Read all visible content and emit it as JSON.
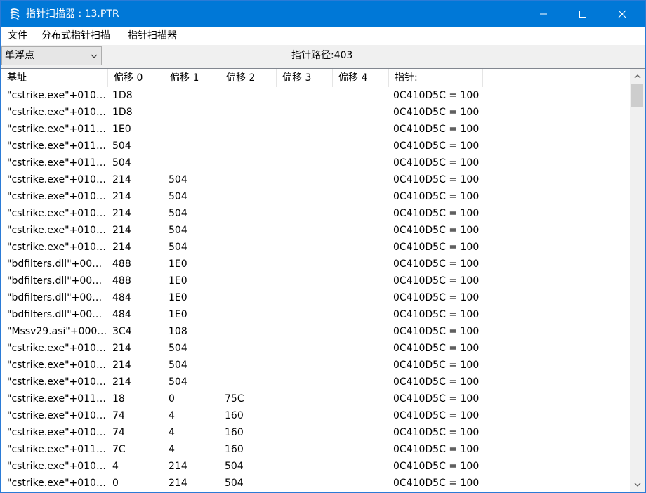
{
  "window": {
    "title": "指针扫描器 : 13.PTR",
    "icon": "cheat-engine-icon",
    "accent_color": "#0078d7"
  },
  "menu": {
    "items": [
      {
        "label": "文件"
      },
      {
        "label": "分布式指针扫描"
      },
      {
        "label": "指针扫描器"
      }
    ]
  },
  "toolbar": {
    "value_type": "单浮点",
    "path_count": "指针路径:403"
  },
  "table": {
    "columns": [
      "基址",
      "偏移 0",
      "偏移 1",
      "偏移 2",
      "偏移 3",
      "偏移 4",
      "指针:"
    ],
    "rows": [
      [
        "\"cstrike.exe\"+010…",
        "1D8",
        "",
        "",
        "",
        "",
        "0C410D5C = 100"
      ],
      [
        "\"cstrike.exe\"+010…",
        "1D8",
        "",
        "",
        "",
        "",
        "0C410D5C = 100"
      ],
      [
        "\"cstrike.exe\"+011…",
        "1E0",
        "",
        "",
        "",
        "",
        "0C410D5C = 100"
      ],
      [
        "\"cstrike.exe\"+011…",
        "504",
        "",
        "",
        "",
        "",
        "0C410D5C = 100"
      ],
      [
        "\"cstrike.exe\"+011…",
        "504",
        "",
        "",
        "",
        "",
        "0C410D5C = 100"
      ],
      [
        "\"cstrike.exe\"+010…",
        "214",
        "504",
        "",
        "",
        "",
        "0C410D5C = 100"
      ],
      [
        "\"cstrike.exe\"+010…",
        "214",
        "504",
        "",
        "",
        "",
        "0C410D5C = 100"
      ],
      [
        "\"cstrike.exe\"+010…",
        "214",
        "504",
        "",
        "",
        "",
        "0C410D5C = 100"
      ],
      [
        "\"cstrike.exe\"+010…",
        "214",
        "504",
        "",
        "",
        "",
        "0C410D5C = 100"
      ],
      [
        "\"cstrike.exe\"+010…",
        "214",
        "504",
        "",
        "",
        "",
        "0C410D5C = 100"
      ],
      [
        "\"bdfilters.dll\"+00…",
        "488",
        "1E0",
        "",
        "",
        "",
        "0C410D5C = 100"
      ],
      [
        "\"bdfilters.dll\"+00…",
        "488",
        "1E0",
        "",
        "",
        "",
        "0C410D5C = 100"
      ],
      [
        "\"bdfilters.dll\"+00…",
        "484",
        "1E0",
        "",
        "",
        "",
        "0C410D5C = 100"
      ],
      [
        "\"bdfilters.dll\"+00…",
        "484",
        "1E0",
        "",
        "",
        "",
        "0C410D5C = 100"
      ],
      [
        "\"Mssv29.asi\"+000…",
        "3C4",
        "108",
        "",
        "",
        "",
        "0C410D5C = 100"
      ],
      [
        "\"cstrike.exe\"+010…",
        "214",
        "504",
        "",
        "",
        "",
        "0C410D5C = 100"
      ],
      [
        "\"cstrike.exe\"+010…",
        "214",
        "504",
        "",
        "",
        "",
        "0C410D5C = 100"
      ],
      [
        "\"cstrike.exe\"+010…",
        "214",
        "504",
        "",
        "",
        "",
        "0C410D5C = 100"
      ],
      [
        "\"cstrike.exe\"+011…",
        "18",
        "0",
        "75C",
        "",
        "",
        "0C410D5C = 100"
      ],
      [
        "\"cstrike.exe\"+010…",
        "74",
        "4",
        "160",
        "",
        "",
        "0C410D5C = 100"
      ],
      [
        "\"cstrike.exe\"+010…",
        "74",
        "4",
        "160",
        "",
        "",
        "0C410D5C = 100"
      ],
      [
        "\"cstrike.exe\"+011…",
        "7C",
        "4",
        "160",
        "",
        "",
        "0C410D5C = 100"
      ],
      [
        "\"cstrike.exe\"+010…",
        "4",
        "214",
        "504",
        "",
        "",
        "0C410D5C = 100"
      ],
      [
        "\"cstrike.exe\"+010…",
        "0",
        "214",
        "504",
        "",
        "",
        "0C410D5C = 100"
      ]
    ]
  }
}
